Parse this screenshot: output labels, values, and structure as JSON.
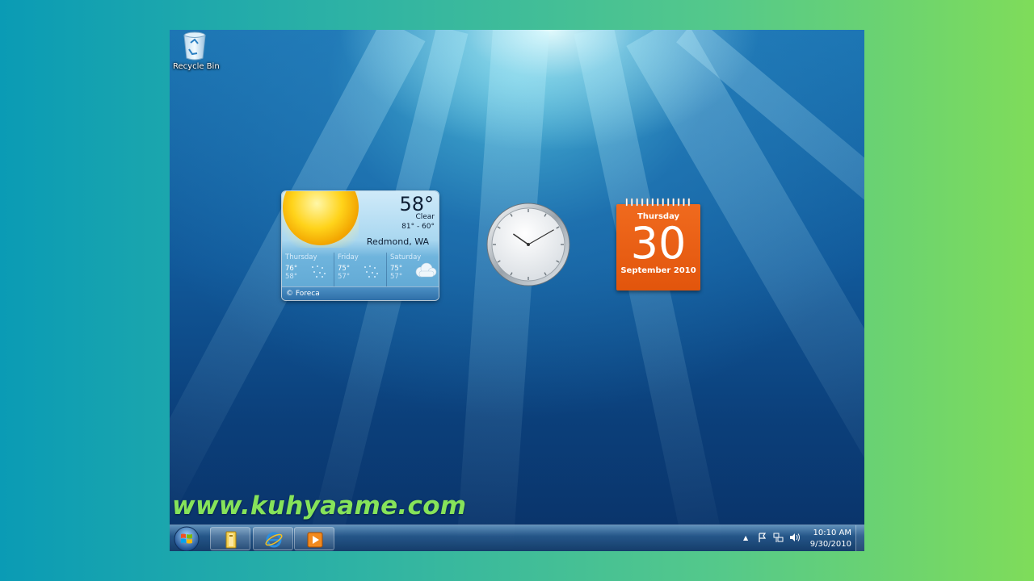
{
  "desktop": {
    "icons": [
      {
        "label": "Recycle Bin",
        "icon": "recycle-bin-icon"
      }
    ]
  },
  "weather": {
    "temperature": "58°",
    "condition": "Clear",
    "range": "81° - 60°",
    "city": "Redmond, WA",
    "forecast": [
      {
        "day": "Thursday",
        "high": "76°",
        "low": "58°",
        "icon": "rain-icon"
      },
      {
        "day": "Friday",
        "high": "75°",
        "low": "57°",
        "icon": "rain-icon"
      },
      {
        "day": "Saturday",
        "high": "75°",
        "low": "57°",
        "icon": "cloudy-icon"
      }
    ],
    "credit": "© Foreca"
  },
  "clock": {
    "hours": 10,
    "minutes": 10
  },
  "calendar": {
    "weekday": "Thursday",
    "date": "30",
    "month_year": "September 2010",
    "accent": "#e8580f"
  },
  "watermark": "www.kuhyaame.com",
  "taskbar": {
    "pinned": [
      {
        "name": "windows-explorer",
        "icon": "folder-icon"
      },
      {
        "name": "internet-explorer",
        "icon": "internet-explorer-icon"
      },
      {
        "name": "media-player",
        "icon": "media-player-icon"
      }
    ],
    "tray": {
      "time": "10:10 AM",
      "date": "9/30/2010"
    }
  }
}
